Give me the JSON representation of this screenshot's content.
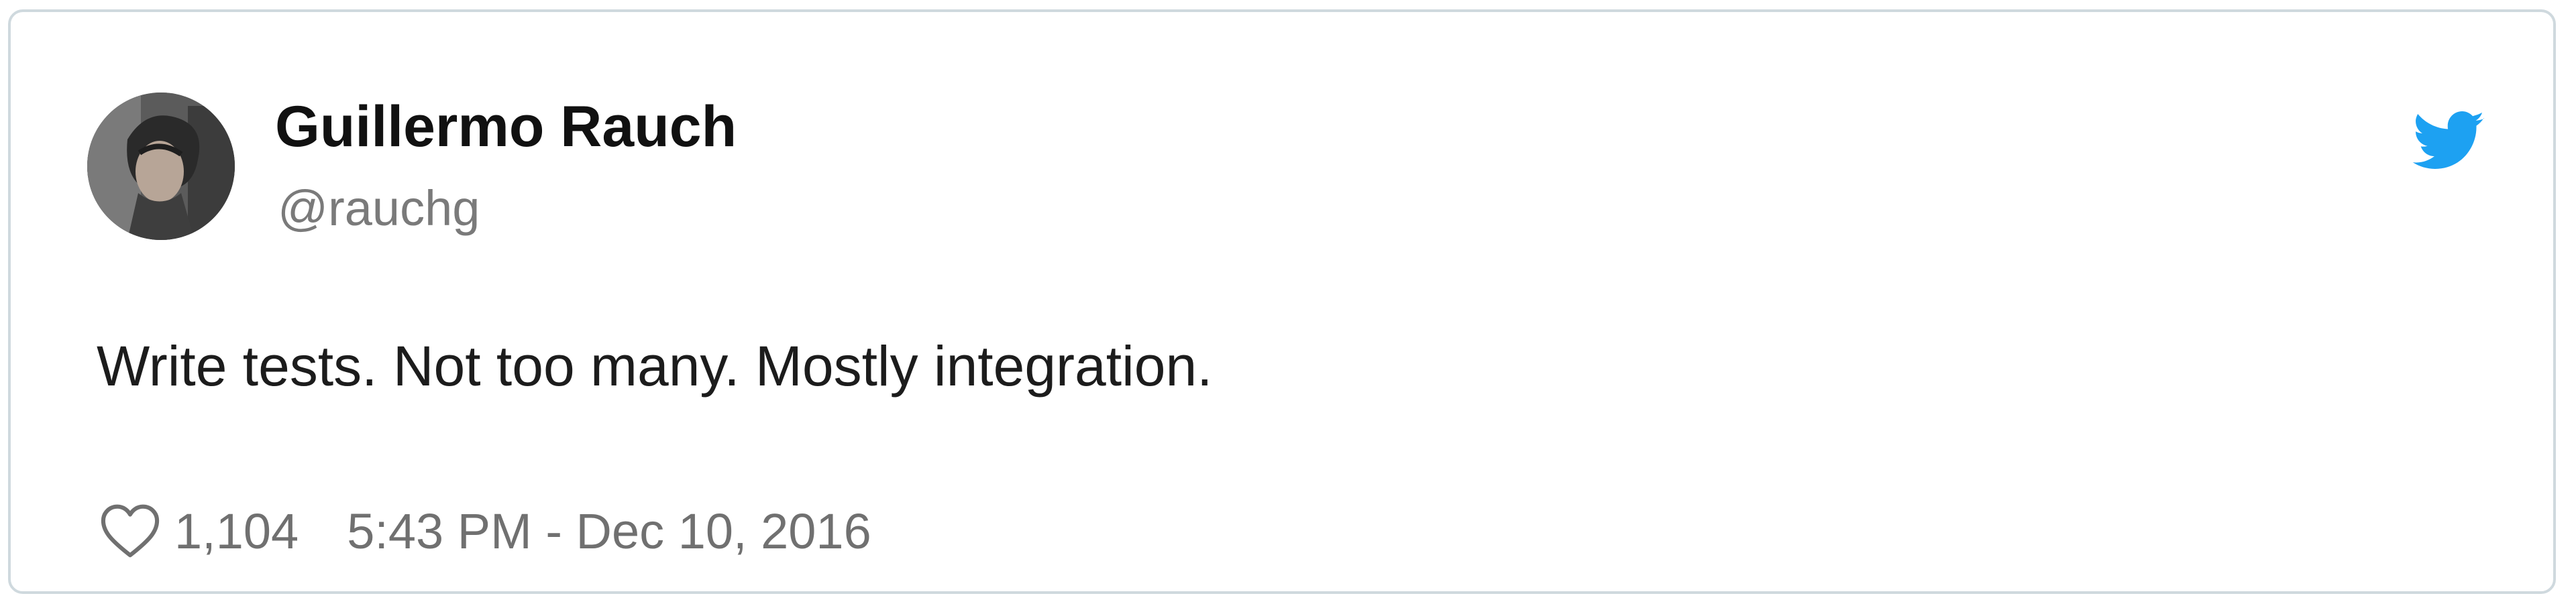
{
  "tweet": {
    "author": {
      "display_name": "Guillermo Rauch",
      "handle": "@rauchg",
      "avatar_icon": "avatar-photo"
    },
    "platform_icon": "twitter-bird-icon",
    "text": "Write tests. Not too many. Mostly integration.",
    "likes_icon": "heart-icon",
    "likes_count": "1,104",
    "timestamp": "5:43 PM - Dec 10, 2016"
  },
  "colors": {
    "border": "#cfd9de",
    "twitter_blue": "#1da1f2",
    "secondary_text": "#707070",
    "primary_text": "#111111"
  }
}
